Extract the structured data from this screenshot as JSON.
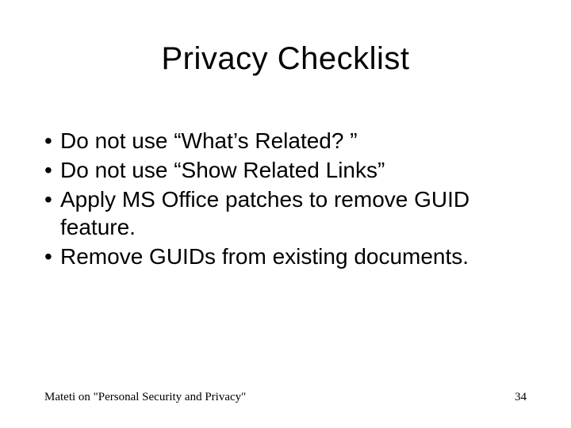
{
  "slide": {
    "title": "Privacy Checklist",
    "bullets": [
      "Do not use “What’s Related? ”",
      "Do not use “Show Related Links”",
      "Apply MS Office patches to remove GUID feature.",
      "Remove GUIDs from existing documents."
    ],
    "footer_left": "Mateti on \"Personal Security and Privacy\"",
    "footer_right": "34"
  }
}
